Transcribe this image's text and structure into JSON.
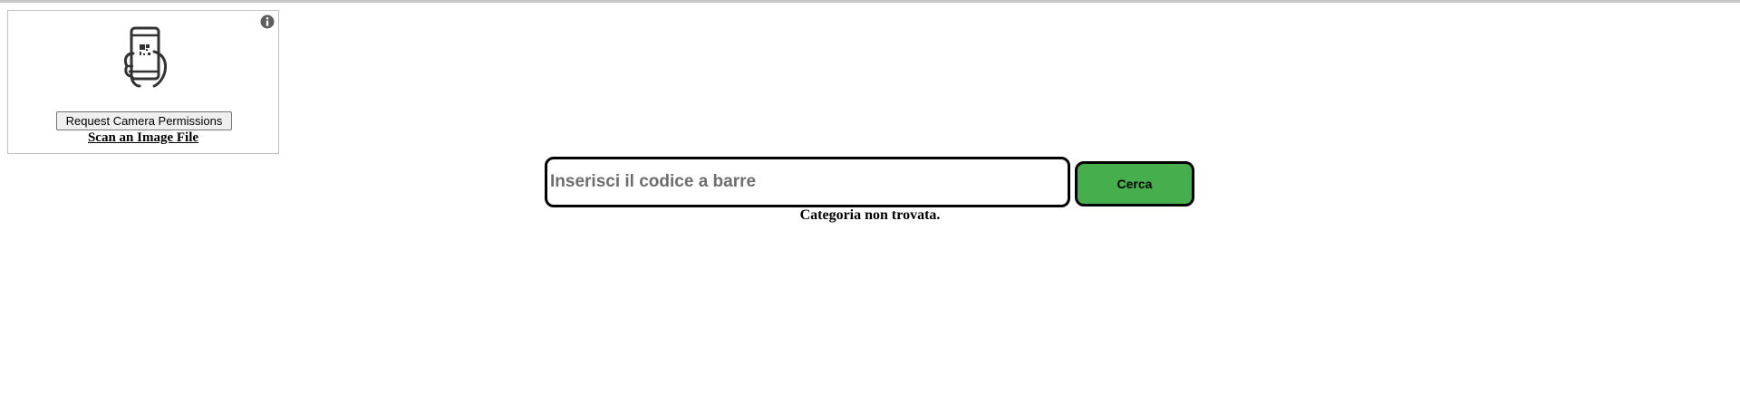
{
  "scanner": {
    "info_icon": "info-icon",
    "phone_icon": "phone-qr-scan-icon",
    "camera_button_label": "Request Camera Permissions",
    "scan_file_label": "Scan an Image File"
  },
  "search": {
    "placeholder": "Inserisci il codice a barre",
    "value": "",
    "button_label": "Cerca"
  },
  "status": {
    "message": "Categoria non trovata."
  },
  "colors": {
    "search_button": "#46ae4c",
    "border": "#000000",
    "placeholder": "#6e6e6e"
  }
}
